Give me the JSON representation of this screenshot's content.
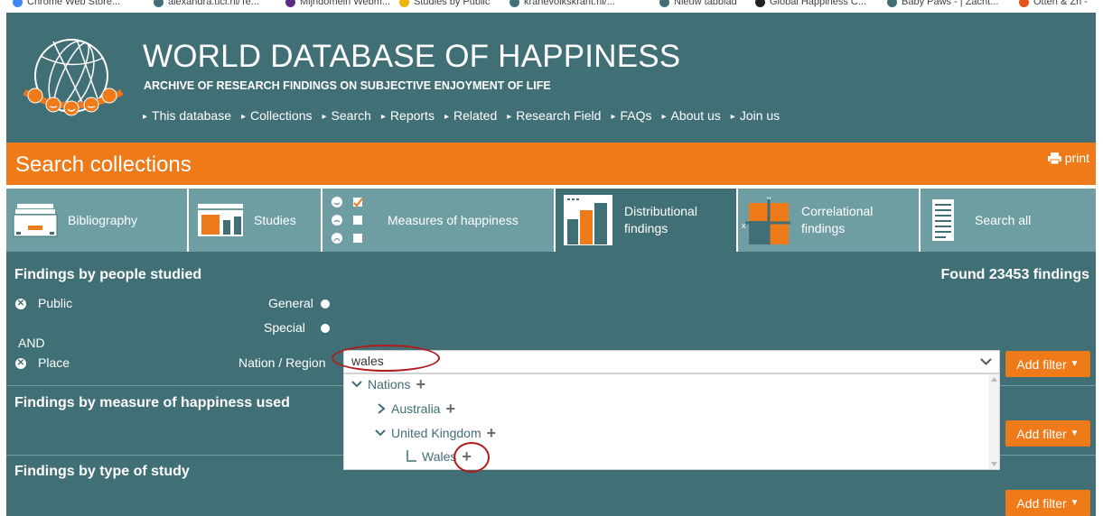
{
  "bookmarks": [
    {
      "label": "Chrome Web Store...",
      "color": "#4285f4"
    },
    {
      "label": "alexandra.ucl.nl/Te...",
      "color": "#406f75"
    },
    {
      "label": "Mijndomein Webm...",
      "color": "#5a2d82"
    },
    {
      "label": "Studies by Public",
      "color": "#f0b400"
    },
    {
      "label": "kranevolkskrant.nl/...",
      "color": "#406f75"
    },
    {
      "label": "Nieuw tabblad",
      "color": "#406f75"
    },
    {
      "label": "Global Happiness C...",
      "color": "#222222"
    },
    {
      "label": "Baby Paws - | Zacht...",
      "color": "#406f75"
    },
    {
      "label": "Otten & Zn -",
      "color": "#e8501a"
    }
  ],
  "header": {
    "title": "WORLD DATABASE OF HAPPINESS",
    "subtitle": "ARCHIVE OF RESEARCH FINDINGS ON SUBJECTIVE ENJOYMENT OF LIFE",
    "nav": [
      "This database",
      "Collections",
      "Search",
      "Reports",
      "Related",
      "Research Field",
      "FAQs",
      "About us",
      "Join us"
    ]
  },
  "search_bar": {
    "title": "Search collections",
    "print_label": "print"
  },
  "tabs": [
    {
      "label": "Bibliography",
      "icon": "bibliography-icon",
      "active": false
    },
    {
      "label": "Studies",
      "icon": "studies-icon",
      "active": false
    },
    {
      "label": "Measures of happiness",
      "icon": "measures-icon",
      "active": false
    },
    {
      "label": "Distributional findings",
      "label_line1": "Distributional",
      "label_line2": "findings",
      "icon": "distribution-icon",
      "active": true
    },
    {
      "label": "Correlational findings",
      "label_line1": "Correlational",
      "label_line2": "findings",
      "icon": "correlation-icon",
      "active": false
    },
    {
      "label": "Search all",
      "icon": "document-icon",
      "active": false
    }
  ],
  "filters": {
    "people": {
      "title": "Findings by people studied",
      "found": "Found 23453 findings",
      "public_label": "Public",
      "options": [
        "General",
        "Special"
      ],
      "and_label": "AND",
      "place_label": "Place",
      "nation_label": "Nation / Region"
    },
    "measure": {
      "title": "Findings by measure of happiness used"
    },
    "study_type": {
      "title": "Findings by type of study"
    },
    "add_filter_label": "Add filter"
  },
  "select": {
    "value": "wales",
    "tree": [
      {
        "label": "Nations",
        "expanded": true,
        "level": 0
      },
      {
        "label": "Australia",
        "expanded": false,
        "level": 1
      },
      {
        "label": "United Kingdom",
        "expanded": true,
        "level": 1
      },
      {
        "label": "Wales",
        "level": 2
      }
    ]
  },
  "colors": {
    "teal": "#406f75",
    "teal_light": "#6f9ea2",
    "orange": "#ee7a1a",
    "annotation_red": "#b01c1c"
  }
}
